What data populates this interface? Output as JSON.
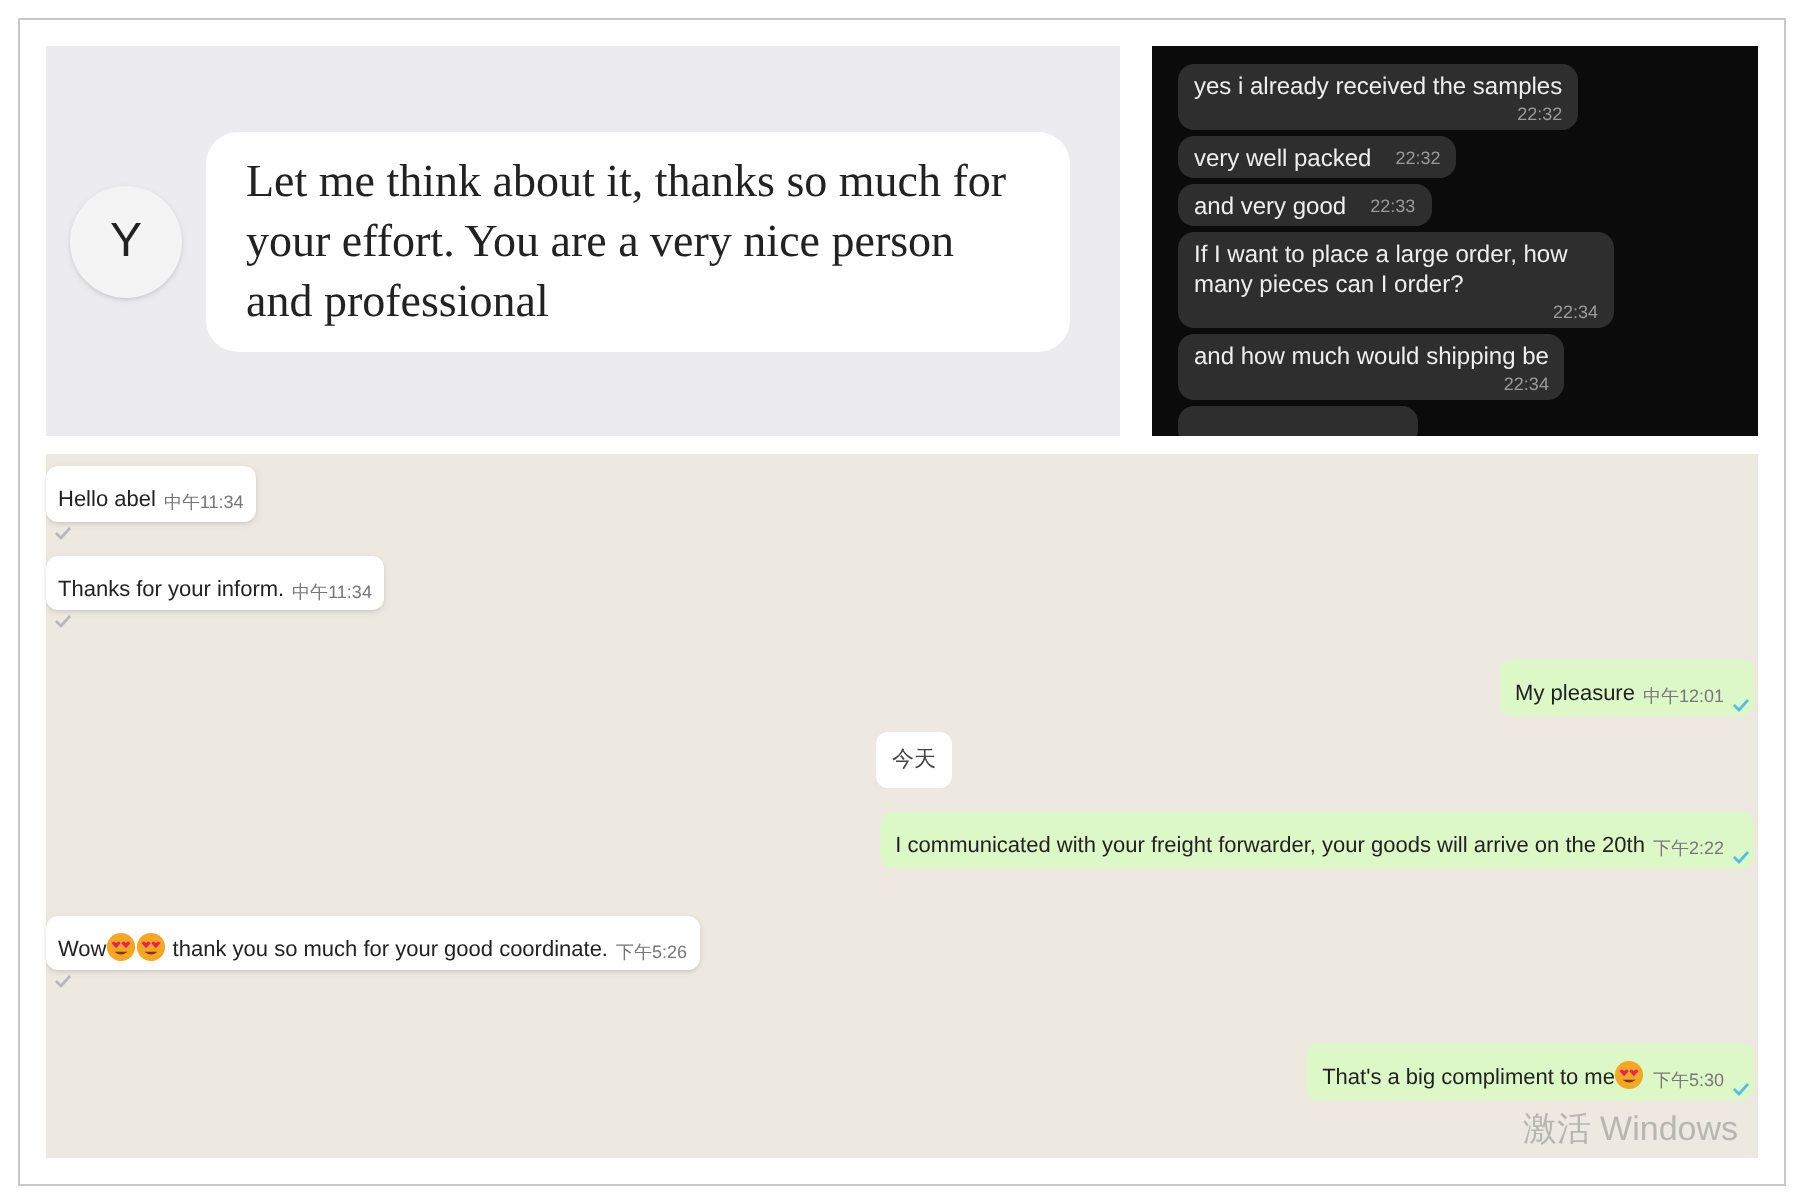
{
  "review_card": {
    "avatar": "Y",
    "message": "Let me think about it, thanks so much for your effort. You are a very nice person and professional"
  },
  "dark_chat": {
    "messages": [
      {
        "kind": "stacked",
        "text": "yes i already received the samples",
        "time": "22:32"
      },
      {
        "kind": "inline",
        "text": "very well packed",
        "time": "22:32"
      },
      {
        "kind": "inline",
        "text": "and very good",
        "time": "22:33"
      },
      {
        "kind": "stacked",
        "text": "If I want to place a large order, how many pieces can I order?",
        "time": "22:34"
      },
      {
        "kind": "stacked",
        "text": "and how much would shipping be",
        "time": "22:34"
      }
    ]
  },
  "light_chat": {
    "items": [
      {
        "kind": "incoming",
        "parts": [
          {
            "kind": "text",
            "text": "Hello abel"
          }
        ],
        "time": "中午11:34"
      },
      {
        "kind": "incoming",
        "parts": [
          {
            "kind": "text",
            "text": "Thanks for your inform."
          }
        ],
        "time": "中午11:34"
      },
      {
        "kind": "outgoing",
        "parts": [
          {
            "kind": "text",
            "text": "My pleasure"
          }
        ],
        "time": "中午12:01"
      },
      {
        "kind": "date",
        "text": "今天"
      },
      {
        "kind": "outgoing",
        "parts": [
          {
            "kind": "text",
            "text": "I communicated with your freight forwarder, your goods will arrive on the 20th"
          }
        ],
        "time": "下午2:22"
      },
      {
        "kind": "incoming",
        "parts": [
          {
            "kind": "text",
            "text": "Wow"
          },
          {
            "kind": "emoji"
          },
          {
            "kind": "emoji"
          },
          {
            "kind": "text",
            "text": " thank you so much for your good coordinate."
          }
        ],
        "time": "下午5:26"
      },
      {
        "kind": "outgoing",
        "parts": [
          {
            "kind": "text",
            "text": "That's a big compliment to me"
          },
          {
            "kind": "emoji"
          }
        ],
        "time": "下午5:30"
      }
    ],
    "activation_notice": "激活 Windows"
  }
}
